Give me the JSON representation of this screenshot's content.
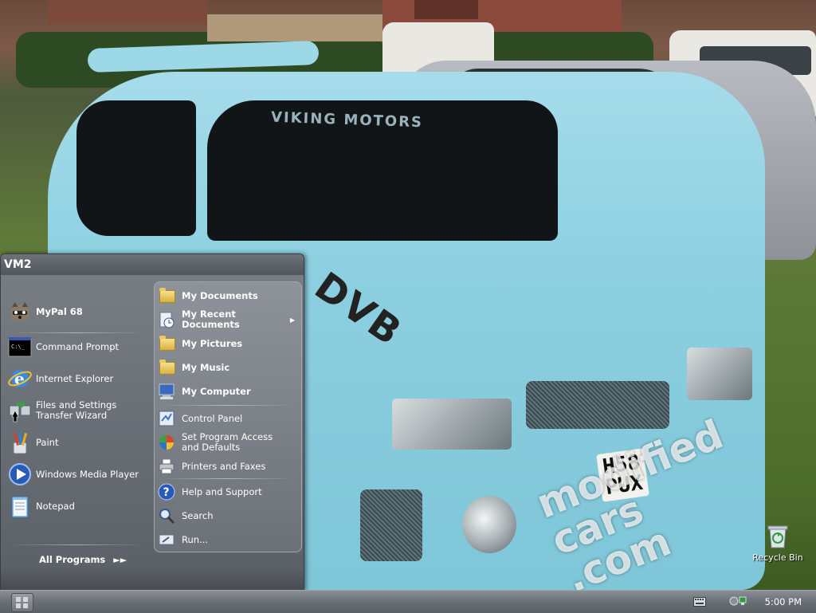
{
  "start_menu": {
    "user_name": "VM2",
    "pinned": [
      {
        "label": "MyPal 68",
        "icon": "raccoon-icon"
      }
    ],
    "recent": [
      {
        "label": "Command Prompt",
        "icon": "command-prompt-icon"
      },
      {
        "label": "Internet Explorer",
        "icon": "internet-explorer-icon"
      },
      {
        "label": "Files and Settings\nTransfer Wizard",
        "icon": "transfer-wizard-icon"
      },
      {
        "label": "Paint",
        "icon": "paint-icon"
      },
      {
        "label": "Windows Media Player",
        "icon": "media-player-icon"
      },
      {
        "label": "Notepad",
        "icon": "notepad-icon"
      }
    ],
    "all_programs_label": "All Programs",
    "right": [
      {
        "label": "My Documents",
        "icon": "folder-icon"
      },
      {
        "label": "My Recent\nDocuments",
        "icon": "recent-documents-icon",
        "has_submenu": true
      },
      {
        "label": "My Pictures",
        "icon": "folder-icon"
      },
      {
        "label": "My Music",
        "icon": "folder-icon"
      },
      {
        "label": "My Computer",
        "icon": "computer-icon"
      },
      {
        "label": "Control Panel",
        "icon": "control-panel-icon"
      },
      {
        "label": "Set Program Access\nand Defaults",
        "icon": "program-access-icon"
      },
      {
        "label": "Printers and Faxes",
        "icon": "printer-icon"
      },
      {
        "label": "Help and Support",
        "icon": "help-icon"
      },
      {
        "label": "Search",
        "icon": "search-icon"
      },
      {
        "label": "Run...",
        "icon": "run-icon"
      }
    ]
  },
  "desktop": {
    "icons": [
      {
        "label": "Recycle Bin",
        "icon": "recycle-bin-icon"
      }
    ],
    "wallpaper": {
      "visor_text": "VIKING MOTORS",
      "hood_decal": "DVB",
      "plate_text": "H58\nPUX",
      "watermark": "modified\ncars\n.com"
    }
  },
  "taskbar": {
    "clock": "5:00 PM",
    "tray_icons": [
      "keyboard-icon",
      "network-icon"
    ]
  },
  "colors": {
    "menu_bg": "#6a6f76",
    "taskbar_bg": "#6a6f76",
    "car_blue": "#8ccfe0"
  }
}
